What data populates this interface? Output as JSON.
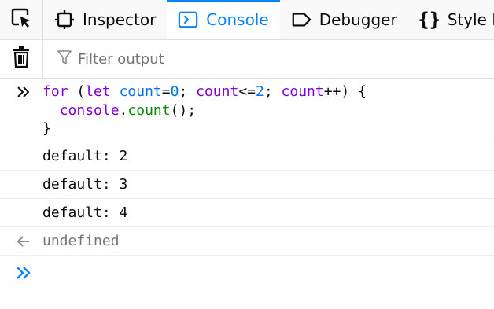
{
  "toolbar": {
    "tabs": [
      {
        "label": "Inspector",
        "icon": "inspector-icon"
      },
      {
        "label": "Console",
        "icon": "console-icon",
        "active": true
      },
      {
        "label": "Debugger",
        "icon": "debugger-icon"
      },
      {
        "label": "Style Edi",
        "icon": "style-editor-icon"
      }
    ]
  },
  "filter": {
    "placeholder": "Filter output"
  },
  "input_code": {
    "line1": {
      "for": "for",
      "open": " (",
      "let": "let",
      "sp": " ",
      "count1": "count",
      "eq": "=",
      "zero": "0",
      "semi1": "; ",
      "count2": "count",
      "le": "<=",
      "two": "2",
      "semi2": "; ",
      "count3": "count",
      "inc": "++",
      "close": ") {"
    },
    "line2": {
      "indent": "  ",
      "console": "console",
      "dot": ".",
      "count": "count",
      "call": "();"
    },
    "line3": "}"
  },
  "messages": [
    "default: 2",
    "default: 3",
    "default: 4"
  ],
  "result": "undefined",
  "colors": {
    "accent": "#0a84ff",
    "keyword": "#8000d7",
    "variable": "#0074e8",
    "function": "#058b00",
    "muted": "#737373"
  }
}
